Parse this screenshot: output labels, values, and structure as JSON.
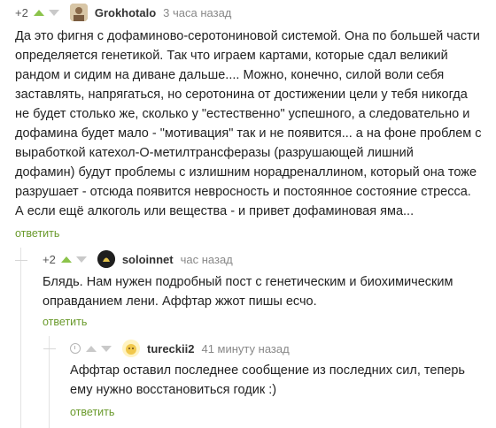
{
  "comments": [
    {
      "rating": "+2",
      "username": "Grokhotalo",
      "time": "3 часа назад",
      "text": "Да это фигня с дофаминово-серотониновой системой. Она по большей части\nопределяется генетикой. Так что играем картами, которые сдал великий\nрандом и сидим на диване дальше.... Можно, конечно, силой воли себя\nзаставлять, напрягаться, но серотонина от достижении цели у тебя никогда\nне будет столько же, сколько у \"естественно\" успешного, а следовательно и\nдофамина будет мало - \"мотивация\" так и не появится... а на фоне проблем с\nвыработкой катехол-О-метилтрансферазы (разрушающей лишний\nдофамин) будут проблемы с излишним норадреналлином, который она тоже\nразрушает - отсюда появится невросность и постоянное состояние стресса.\nА если ещё алкоголь или вещества - и привет дофаминовая яма...",
      "reply": "ответить"
    },
    {
      "rating": "+2",
      "username": "soloinnet",
      "time": "час назад",
      "text": "Блядь. Нам нужен подробный пост с генетическим и биохимическим\nоправданием лени. Аффтар жжот пишы есчо.",
      "reply": "ответить"
    },
    {
      "username": "tureckii2",
      "time": "41 минуту назад",
      "text": "Аффтар оставил последнее сообщение из последних сил, теперь\nему нужно восстановиться годик :)",
      "reply": "ответить"
    }
  ],
  "colors": {
    "accent": "#6a9a2c",
    "vote_up": "#8bc34a",
    "muted": "#888888"
  },
  "icons": [
    "vote-up-icon",
    "vote-down-icon",
    "avatar",
    "clock-icon"
  ]
}
